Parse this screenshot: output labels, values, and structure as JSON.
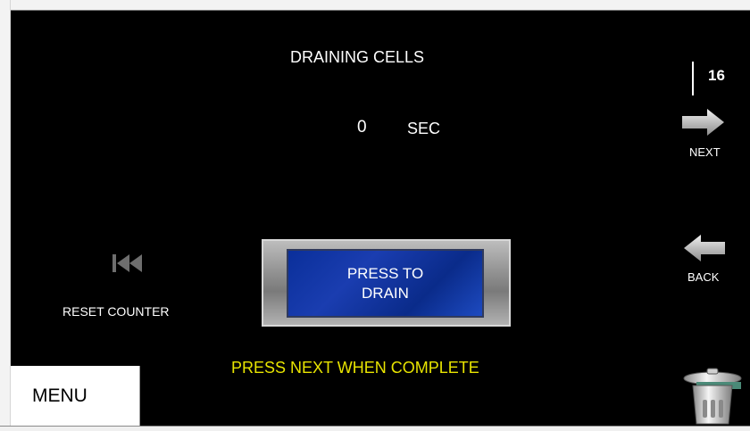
{
  "screen": {
    "title": "DRAINING CELLS",
    "timer": {
      "value": "0",
      "unit": "SEC"
    },
    "page_number": "16",
    "instruction": "PRESS NEXT WHEN  COMPLETE"
  },
  "navigation": {
    "next_label": "NEXT",
    "back_label": "BACK",
    "next_icon": "arrow-right-icon",
    "back_icon": "arrow-left-icon"
  },
  "controls": {
    "drain_button_label": "PRESS TO\nDRAIN",
    "reset_label": "RESET COUNTER",
    "reset_icon": "skip-back-icon",
    "menu_label": "MENU",
    "trash_icon": "trash-can-icon"
  },
  "colors": {
    "background": "#000000",
    "text": "#ffffff",
    "instruction": "#e8e400",
    "drain_button": "#1a3db0"
  }
}
